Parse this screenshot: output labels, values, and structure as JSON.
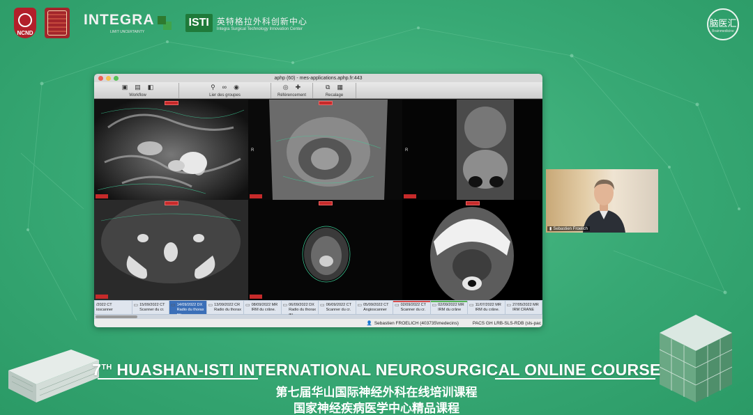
{
  "window": {
    "title": "aphp (60) - mes-applications.aphp.fr:443",
    "toolbar_groups": [
      {
        "label": "Workflow"
      },
      {
        "label": "Lier des groupes"
      },
      {
        "label": "Référencement"
      },
      {
        "label": "Recalage"
      }
    ],
    "viewports": [
      {
        "pos_label": ""
      },
      {
        "pos_label": "R"
      },
      {
        "pos_label": "R"
      },
      {
        "pos_label": ""
      },
      {
        "pos_label": ""
      },
      {
        "pos_label": ""
      }
    ],
    "studies": [
      {
        "date": "/2022 CT",
        "desc": "ioscanner"
      },
      {
        "date": "15/09/2022 CT",
        "desc": "Scanner du cr."
      },
      {
        "date": "14/09/2022 DX",
        "desc": "Radio du thorax au."
      },
      {
        "date": "13/09/2022 CR",
        "desc": "Radio du thorax"
      },
      {
        "date": "08/09/2022 MR",
        "desc": "IRM du crâne."
      },
      {
        "date": "06/09/2022 DX",
        "desc": "Radio du thorax au."
      },
      {
        "date": "06/09/2022 CT",
        "desc": "Scanner du cr."
      },
      {
        "date": "05/09/2022 CT",
        "desc": "Angioscanner"
      },
      {
        "date": "02/09/2022 CT",
        "desc": "Scanner du cr."
      },
      {
        "date": "02/09/2022 MR",
        "desc": "IRM du crâne"
      },
      {
        "date": "11/07/2022 MR",
        "desc": "IRM du crâne."
      },
      {
        "date": "27/05/2022 MR",
        "desc": "IRM CRANE"
      }
    ],
    "status_user": "Sebastien FROELICH (403735\\medecins)",
    "status_site": "PACS GH LRB-SLS-RDB (sls-pac"
  },
  "video": {
    "name": "Sebastien Froelich"
  },
  "logos": {
    "ncnd": "NCND",
    "integra": "INTEGRA",
    "integra_sub": "LIMIT UNCERTAINTY",
    "isti": "ISTI",
    "isti_cn": "英特格拉外科创新中心",
    "isti_en": "Integra Surgical Technology Innovation Center",
    "right_cn": "脑医汇",
    "right_en": "Brainmedicine"
  },
  "course": {
    "num": "7",
    "sup": "TH",
    "title": "HUASHAN-ISTI INTERNATIONAL NEUROSURGICAL ONLINE COURSE",
    "cn_line1": "第七届华山国际神经外科在线培训课程",
    "cn_line2": "国家神经疾病医学中心精品课程"
  },
  "colors": {
    "background": "#37a874",
    "accent_red": "#c62a2a",
    "selected_study": "#3b6fb8"
  },
  "icons": {
    "toolbar": [
      "workflow-icon",
      "link-icon",
      "target-icon",
      "registration-icon"
    ],
    "study": "film-icon",
    "user": "person-icon",
    "mic": "mic-icon"
  }
}
